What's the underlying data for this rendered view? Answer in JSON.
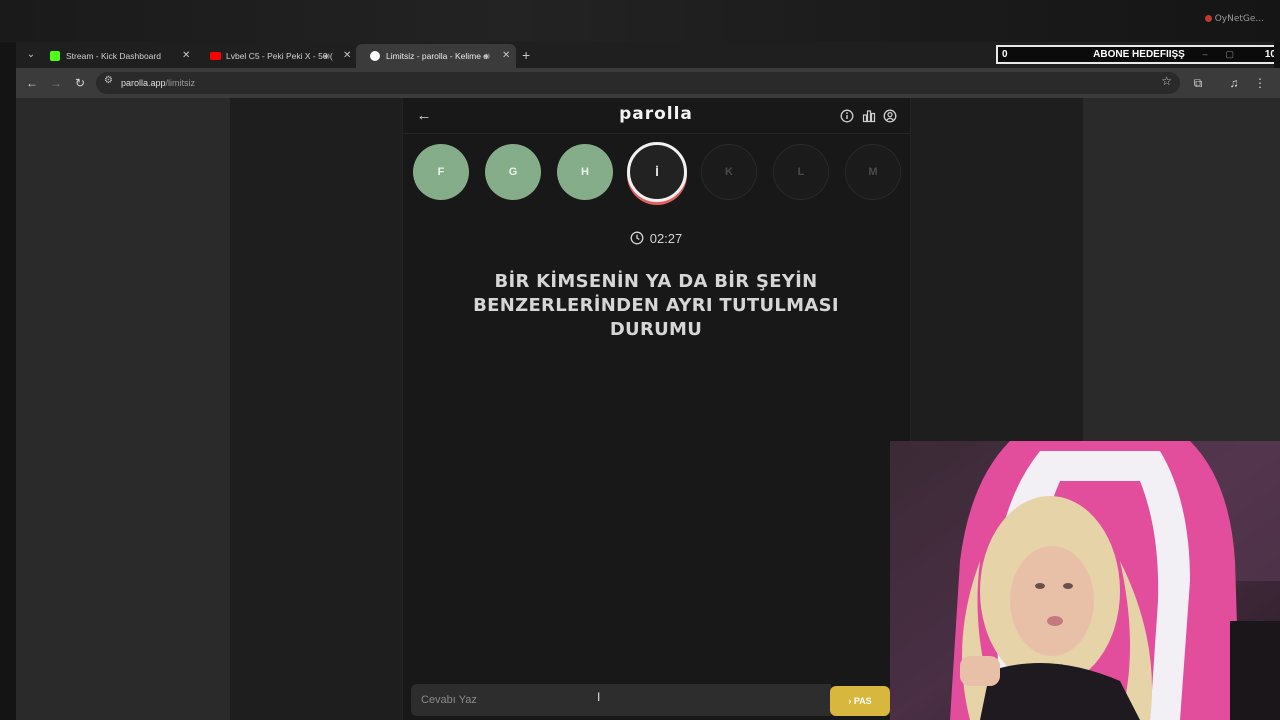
{
  "overlay": {
    "brand": "OyNetGe..."
  },
  "tabs": [
    {
      "title": "Stream - Kick Dashboard",
      "favicon_color": "#53fc18"
    },
    {
      "title": "Lvbel C5 - Peki Peki X - 50 (",
      "favicon_color": "#ff0000"
    },
    {
      "title": "Limitsiz - parolla - Kelime o",
      "favicon_color": "#ffffff"
    }
  ],
  "goal": {
    "current": "0",
    "label": "ABONE HEDEFIIŞŞ",
    "target": "10"
  },
  "address": {
    "host": "parolla.app",
    "path": "/limitsiz"
  },
  "app": {
    "title": "parolla",
    "letters": [
      {
        "char": "F",
        "state": "done"
      },
      {
        "char": "G",
        "state": "done"
      },
      {
        "char": "H",
        "state": "done"
      },
      {
        "char": "İ",
        "state": "current"
      },
      {
        "char": "K",
        "state": "todo"
      },
      {
        "char": "L",
        "state": "todo"
      },
      {
        "char": "M",
        "state": "todo"
      }
    ],
    "timer": "02:27",
    "question": "BİR KİMSENİN YA DA BİR ŞEYİN BENZERLERİNDEN AYRI TUTULMASI DURUMU",
    "answer_placeholder": "Cevabı Yaz",
    "pass_label": "PAS"
  },
  "colors": {
    "done": "#85ad89",
    "pass": "#d7b73d",
    "current_ring": "#f0f0f0",
    "current_shadow": "#e26060"
  },
  "icons": [
    "back-arrow-icon",
    "info-icon",
    "stats-icon",
    "profile-icon",
    "clock-icon",
    "chevron-right-icon"
  ]
}
